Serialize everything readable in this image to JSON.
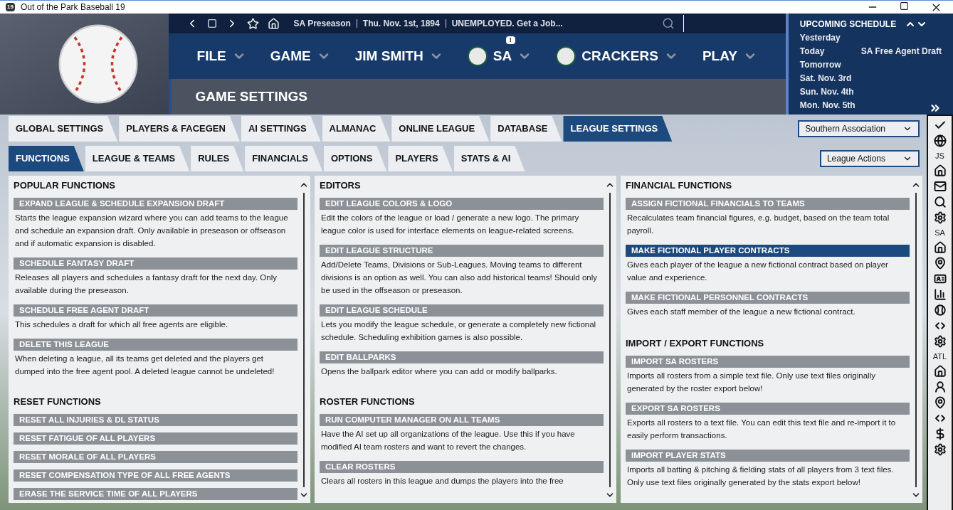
{
  "window": {
    "app_icon": "19",
    "title": "Out of the Park Baseball 19"
  },
  "status": [
    "SA Preseason",
    "Thu. Nov. 1st, 1894",
    "UNEMPLOYED. Get a Job..."
  ],
  "menus": [
    {
      "label": "FILE",
      "kind": "plain"
    },
    {
      "label": "GAME",
      "kind": "plain"
    },
    {
      "label": "JIM SMITH",
      "kind": "plain"
    },
    {
      "label": "SA",
      "kind": "logo",
      "badge": "!"
    },
    {
      "label": "CRACKERS",
      "kind": "logo"
    },
    {
      "label": "PLAY",
      "kind": "plain"
    }
  ],
  "page_title": "GAME SETTINGS",
  "schedule": {
    "title": "UPCOMING SCHEDULE",
    "rows": [
      {
        "day": "Yesterday"
      },
      {
        "day": "Today",
        "event": "SA Free Agent Draft"
      },
      {
        "day": "Tomorrow"
      },
      {
        "day": "Sat. Nov. 3rd"
      },
      {
        "day": "Sun. Nov. 4th"
      },
      {
        "day": "Mon. Nov. 5th"
      }
    ]
  },
  "tabs": [
    {
      "label": "GLOBAL SETTINGS",
      "selected": false
    },
    {
      "label": "PLAYERS & FACEGEN",
      "selected": false
    },
    {
      "label": "AI SETTINGS",
      "selected": false
    },
    {
      "label": "ALMANAC",
      "selected": false
    },
    {
      "label": "ONLINE LEAGUE",
      "selected": false
    },
    {
      "label": "DATABASE",
      "selected": false
    },
    {
      "label": "LEAGUE SETTINGS",
      "selected": true
    }
  ],
  "league_select": "Southern Association",
  "subtabs": [
    {
      "label": "FUNCTIONS",
      "selected": true
    },
    {
      "label": "LEAGUE & TEAMS",
      "selected": false
    },
    {
      "label": "RULES",
      "selected": false
    },
    {
      "label": "FINANCIALS",
      "selected": false
    },
    {
      "label": "OPTIONS",
      "selected": false
    },
    {
      "label": "PLAYERS",
      "selected": false
    },
    {
      "label": "STATS & AI",
      "selected": false
    }
  ],
  "actions_select": "League Actions",
  "panels": [
    {
      "sections": [
        {
          "title": "POPULAR FUNCTIONS",
          "items": [
            {
              "label": "EXPAND LEAGUE & SCHEDULE EXPANSION DRAFT",
              "description": "Starts the league expansion wizard where you can add teams to the league and schedule an expansion draft. Only available in preseason or offseason and if automatic expansion is disabled.",
              "selected": false
            },
            {
              "label": "SCHEDULE FANTASY DRAFT",
              "description": "Releases all players and schedules a fantasy draft for the next day. Only available during the preseason.",
              "selected": false
            },
            {
              "label": "SCHEDULE FREE AGENT DRAFT",
              "description": "This schedules a draft for which all free agents are eligible.",
              "selected": false
            },
            {
              "label": "DELETE THIS LEAGUE",
              "description": "When deleting a league, all its teams get deleted and the players get dumped into the free agent pool. A deleted league cannot be undeleted!",
              "selected": false
            }
          ]
        },
        {
          "title": "RESET FUNCTIONS",
          "items": [
            {
              "label": "RESET ALL INJURIES & DL STATUS",
              "selected": false
            },
            {
              "label": "RESET FATIGUE OF ALL PLAYERS",
              "selected": false
            },
            {
              "label": "RESET MORALE OF ALL PLAYERS",
              "selected": false
            },
            {
              "label": "RESET COMPENSATION TYPE OF ALL FREE AGENTS",
              "selected": false
            },
            {
              "label": "ERASE THE SERVICE TIME OF ALL PLAYERS",
              "selected": false
            }
          ]
        }
      ]
    },
    {
      "sections": [
        {
          "title": "EDITORS",
          "items": [
            {
              "label": "EDIT LEAGUE COLORS & LOGO",
              "description": "Edit the colors of the league or load / generate a new logo. The primary league color is used for interface elements on league-related screens.",
              "selected": false
            },
            {
              "label": "EDIT LEAGUE STRUCTURE",
              "description": "Add/Delete Teams, Divisions or Sub-Leagues. Moving teams to different divisions is an option as well. You can also add historical teams! Should only be used in the offseason or preseason.",
              "selected": false
            },
            {
              "label": "EDIT LEAGUE SCHEDULE",
              "description": "Lets you modify the league schedule, or generate a completely new fictional schedule. Scheduling exhibition games is also possible.",
              "selected": false
            },
            {
              "label": "EDIT BALLPARKS",
              "description": "Opens the ballpark editor where you can add or modify ballparks.",
              "selected": false
            }
          ]
        },
        {
          "title": "ROSTER FUNCTIONS",
          "items": [
            {
              "label": "RUN COMPUTER MANAGER ON ALL TEAMS",
              "description": "Have the AI set up all organizations of the league. Use this if you have modified AI team rosters and want to revert the changes.",
              "selected": false
            },
            {
              "label": "CLEAR ROSTERS",
              "description": "Clears all rosters in this league and dumps the players into the free",
              "selected": false
            }
          ]
        }
      ]
    },
    {
      "sections": [
        {
          "title": "FINANCIAL FUNCTIONS",
          "items": [
            {
              "label": "ASSIGN FICTIONAL FINANCIALS TO TEAMS",
              "description": "Recalculates team financial figures, e.g. budget, based on the team total payroll.",
              "selected": false
            },
            {
              "label": "MAKE FICTIONAL PLAYER CONTRACTS",
              "description": "Gives each player of the league a new fictional contract based on player value and experience.",
              "selected": true
            },
            {
              "label": "MAKE FICTIONAL PERSONNEL CONTRACTS",
              "description": "Gives each staff member of the league a new fictional contract.",
              "selected": false
            }
          ]
        },
        {
          "title": "IMPORT / EXPORT FUNCTIONS",
          "items": [
            {
              "label": "IMPORT SA ROSTERS",
              "description": "Imports all rosters from a simple text file. Only use text files originally generated by the roster export below!",
              "selected": false
            },
            {
              "label": "EXPORT SA ROSTERS",
              "description": "Exports all rosters to a text file. You can edit this text file and re-import it to easily perform transactions.",
              "selected": false
            },
            {
              "label": "IMPORT PLAYER STATS",
              "description": "Imports all batting & pitching & fielding stats of all players from 3 text files. Only use text files originally generated by the stats export below!",
              "selected": false
            }
          ]
        }
      ]
    }
  ],
  "sidebar": [
    {
      "kind": "icon"
    },
    {
      "kind": "icon"
    },
    {
      "kind": "label",
      "text": "JS"
    },
    {
      "kind": "icon"
    },
    {
      "kind": "icon"
    },
    {
      "kind": "icon"
    },
    {
      "kind": "icon"
    },
    {
      "kind": "label",
      "text": "SA"
    },
    {
      "kind": "icon"
    },
    {
      "kind": "icon"
    },
    {
      "kind": "icon"
    },
    {
      "kind": "icon"
    },
    {
      "kind": "icon"
    },
    {
      "kind": "icon"
    },
    {
      "kind": "icon"
    },
    {
      "kind": "label",
      "text": "ATL"
    },
    {
      "kind": "icon"
    },
    {
      "kind": "icon"
    },
    {
      "kind": "icon"
    },
    {
      "kind": "icon"
    },
    {
      "kind": "icon"
    },
    {
      "kind": "icon"
    }
  ]
}
